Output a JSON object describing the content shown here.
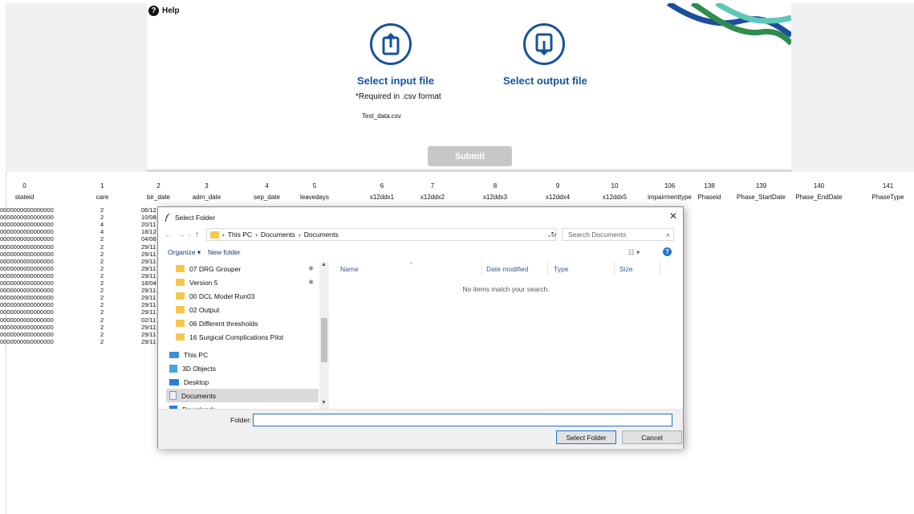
{
  "app": {
    "help_label": "Help",
    "input_label": "Select input file",
    "required_note": "*Required in .csv format",
    "input_filename": "Test_data.csv",
    "output_label": "Select output file",
    "submit_label": "Submit",
    "colors": {
      "accent": "#17539c",
      "wave_dark": "#1b4f9c",
      "wave_mid": "#2f8c4e",
      "wave_light": "#5ec8b8",
      "submit_bg": "#c7c7c7"
    }
  },
  "table": {
    "column_numbers": [
      "0",
      "1",
      "2",
      "3",
      "4",
      "5",
      "6",
      "7",
      "8",
      "9",
      "10",
      "106",
      "138",
      "139",
      "140",
      "141"
    ],
    "column_names": [
      "stateid",
      "care",
      "bir_date",
      "adm_date",
      "sep_date",
      "leavedays",
      "x12ddx1",
      "x12ddx2",
      "x12ddx3",
      "x12ddx4",
      "x12ddx5",
      "impairmenttype",
      "Phaseid",
      "Phase_StartDate",
      "Phase_EndDate",
      "PhaseType"
    ],
    "rows": [
      [
        "0000000000000000",
        "2",
        "06/12"
      ],
      [
        "0000000000000000",
        "2",
        "10/08"
      ],
      [
        "0000000000000000",
        "4",
        "20/11"
      ],
      [
        "0000000000000000",
        "4",
        "18/12"
      ],
      [
        "0000000000000000",
        "2",
        "04/06"
      ],
      [
        "0000000000000000",
        "2",
        "29/11"
      ],
      [
        "0000000000000000",
        "2",
        "29/11"
      ],
      [
        "0000000000000000",
        "2",
        "29/11"
      ],
      [
        "0000000000000000",
        "2",
        "29/11"
      ],
      [
        "0000000000000000",
        "2",
        "29/11"
      ],
      [
        "0000000000000000",
        "2",
        "18/04"
      ],
      [
        "0000000000000000",
        "2",
        "29/11"
      ],
      [
        "0000000000000000",
        "2",
        "29/11"
      ],
      [
        "0000000000000000",
        "2",
        "29/11"
      ],
      [
        "0000000000000000",
        "2",
        "29/11"
      ],
      [
        "0000000000000000",
        "2",
        "02/11"
      ],
      [
        "0000000000000000",
        "2",
        "29/11"
      ],
      [
        "0000000000000000",
        "2",
        "29/11"
      ],
      [
        "0000000000000000",
        "2",
        "29/11"
      ]
    ]
  },
  "dialog": {
    "title": "Select Folder",
    "path": [
      "This PC",
      "Documents",
      "Documents"
    ],
    "search_placeholder": "Search Documents",
    "organize_label": "Organize ▾",
    "new_folder_label": "New folder",
    "nav_items": [
      {
        "label": "07 DRG Grouper",
        "icon": "folder-icon",
        "pinned": true
      },
      {
        "label": "Version 5",
        "icon": "folder-icon",
        "pinned": true
      },
      {
        "label": "00 DCL Model Run03",
        "icon": "folder-icon",
        "pinned": false
      },
      {
        "label": "02 Output",
        "icon": "folder-icon",
        "pinned": false
      },
      {
        "label": "06 Different thresholds",
        "icon": "folder-icon",
        "pinned": false
      },
      {
        "label": "16 Surgical Complications Pilot",
        "icon": "folder-icon",
        "pinned": false
      },
      {
        "label": "This PC",
        "icon": "computer-icon",
        "pinned": false
      },
      {
        "label": "3D Objects",
        "icon": "cube-icon",
        "pinned": false
      },
      {
        "label": "Desktop",
        "icon": "desktop-icon",
        "pinned": false
      },
      {
        "label": "Documents",
        "icon": "documents-icon",
        "pinned": false,
        "selected": true
      },
      {
        "label": "Downloads",
        "icon": "downloads-icon",
        "pinned": false
      }
    ],
    "columns": [
      "Name",
      "Date modified",
      "Type",
      "Size"
    ],
    "empty_message": "No items match your search.",
    "folder_label": "Folder:",
    "folder_value": "",
    "select_button": "Select Folder",
    "cancel_button": "Cancel"
  }
}
